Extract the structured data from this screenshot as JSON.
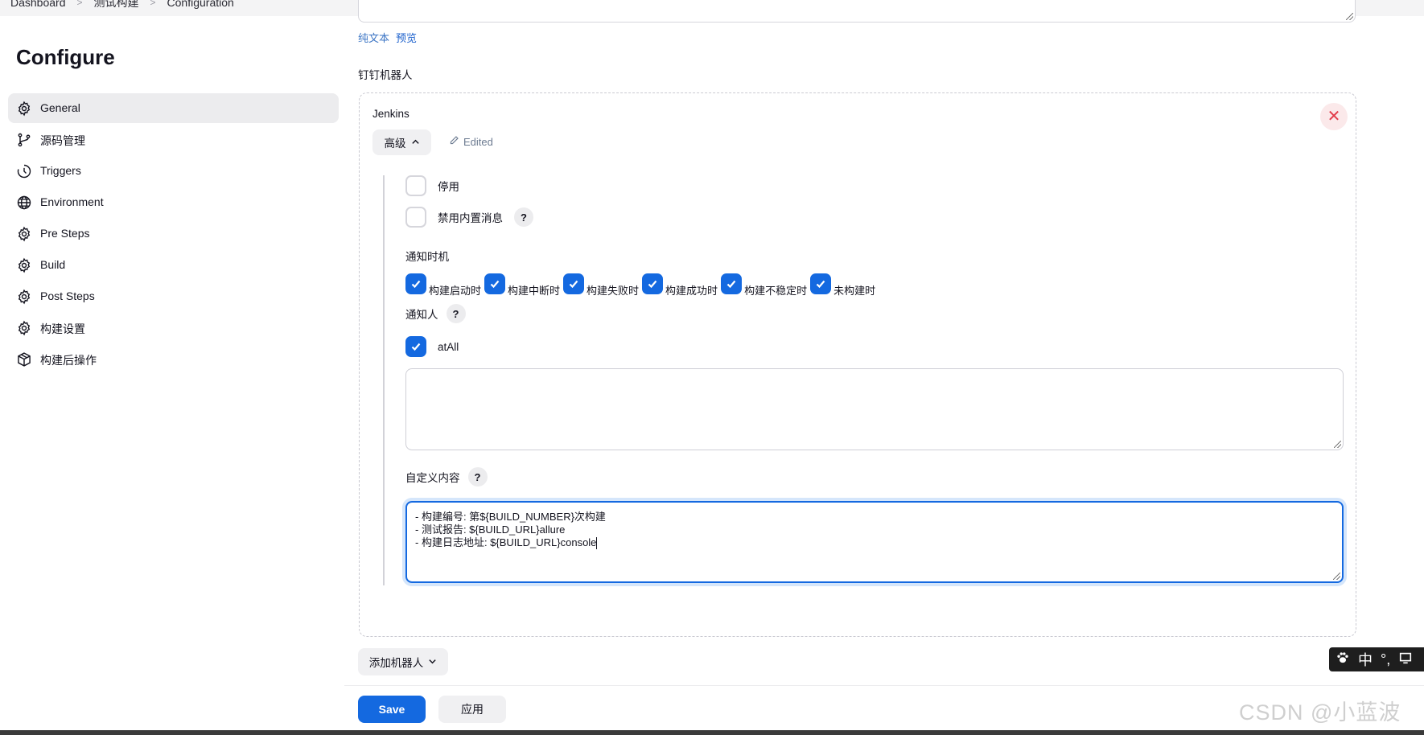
{
  "breadcrumb": [
    "Dashboard",
    "测试构建",
    "Configuration"
  ],
  "page_title": "Configure",
  "sidebar": {
    "items": [
      {
        "label": "General",
        "icon": "gear-icon",
        "active": true
      },
      {
        "label": "源码管理",
        "icon": "branch-icon"
      },
      {
        "label": "Triggers",
        "icon": "clock-icon"
      },
      {
        "label": "Environment",
        "icon": "globe-icon"
      },
      {
        "label": "Pre Steps",
        "icon": "gear-icon"
      },
      {
        "label": "Build",
        "icon": "gear-icon"
      },
      {
        "label": "Post Steps",
        "icon": "gear-icon"
      },
      {
        "label": "构建设置",
        "icon": "gear-icon"
      },
      {
        "label": "构建后操作",
        "icon": "package-icon"
      }
    ]
  },
  "editor_links": {
    "plain_text": "纯文本",
    "preview": "预览"
  },
  "dingtalk": {
    "section_label": "钉钉机器人",
    "robot_name": "Jenkins",
    "advanced_label": "高级",
    "edited_label": "Edited",
    "disable_label": "停用",
    "disable_builtin_label": "禁用内置消息",
    "help_symbol": "?",
    "notify_timing_label": "通知时机",
    "timings": [
      "构建启动时",
      "构建中断时",
      "构建失败时",
      "构建成功时",
      "构建不稳定时",
      "未构建时"
    ],
    "notify_people_label": "通知人",
    "at_all_label": "atAll",
    "custom_content_label": "自定义内容",
    "custom_content_lines": [
      "- 构建编号: 第${BUILD_NUMBER}次构建",
      "- 测试报告: ${BUILD_URL}allure",
      "- 构建日志地址: ${BUILD_URL}console"
    ]
  },
  "add_robot_label": "添加机器人",
  "footer": {
    "save_label": "Save",
    "apply_label": "应用"
  },
  "ime": {
    "mode": "中",
    "punct": "°,"
  },
  "watermark": "CSDN @小蓝波",
  "colors": {
    "accent": "#1469e0",
    "danger": "#e23c4a"
  }
}
